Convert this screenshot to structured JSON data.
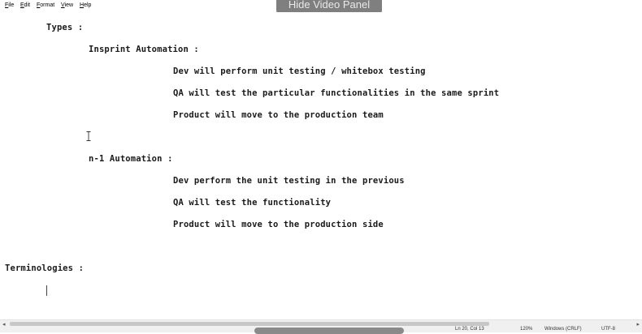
{
  "menu": [
    "File",
    "Edit",
    "Format",
    "View",
    "Help"
  ],
  "overlay": {
    "hide_video_panel": "Hide Video Panel"
  },
  "document": {
    "lines": [
      "Types :",
      "Insprint Automation :",
      "Dev will perform unit testing / whitebox testing",
      "QA will test the particular functionalities in the same sprint",
      "Product will move to the production team",
      "n-1 Automation :",
      "Dev perform the unit testing in the previous",
      "QA will test the functionality",
      "Product will move to the production side",
      "Terminologies :"
    ]
  },
  "status": {
    "position": "Ln 20, Col 13",
    "zoom": "120%",
    "line_ending": "Windows (CRLF)",
    "encoding": "UTF-8"
  }
}
